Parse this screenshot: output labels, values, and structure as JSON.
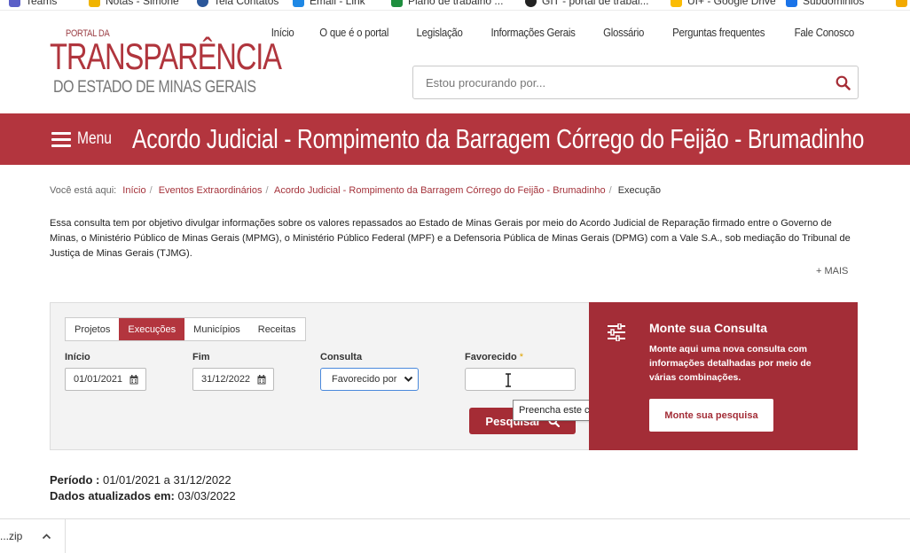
{
  "bookmarks": [
    {
      "label": "Teams",
      "color": "#5b5fc7"
    },
    {
      "label": "Notas - Simone",
      "color": "#f0b400"
    },
    {
      "label": "Tela Contatos",
      "color": "#2b579a"
    },
    {
      "label": "Email - Link",
      "color": "#1e88e5"
    },
    {
      "label": "Plano de trabalho ...",
      "color": "#1e8e3e"
    },
    {
      "label": "GIT - portal de trabal...",
      "color": "#222222"
    },
    {
      "label": "UI+ - Google Drive",
      "color": "#fbbc04"
    },
    {
      "label": "Subdominios",
      "color": "#1a73e8"
    }
  ],
  "logo": {
    "small": "PORTAL DA",
    "big": "TRANSPARÊNCIA",
    "sub": "DO ESTADO DE MINAS GERAIS"
  },
  "topnav": [
    "Início",
    "O que é o portal",
    "Legislação",
    "Informações Gerais",
    "Glossário",
    "Perguntas frequentes",
    "Fale Conosco"
  ],
  "search": {
    "placeholder": "Estou procurando por..."
  },
  "banner": {
    "menu_label": "Menu",
    "title": "Acordo Judicial - Rompimento da Barragem Córrego do Feijão - Brumadinho"
  },
  "breadcrumb": {
    "prefix": "Você está aqui:",
    "items": [
      "Início",
      "Eventos Extraordinários",
      "Acordo Judicial - Rompimento da Barragem Córrego do Feijão - Brumadinho"
    ],
    "current": "Execução"
  },
  "intro": "Essa consulta tem por objetivo divulgar informações sobre os valores repassados ao Estado de Minas Gerais por meio do Acordo Judicial de Reparação firmado entre o Governo de Minas, o Ministério Público de Minas Gerais (MPMG), o Ministério Público Federal (MPF) e a Defensoria Pública de Minas Gerais (DPMG) com a Vale S.A., sob mediação do Tribunal de Justiça de Minas Gerais (TJMG).",
  "mais_label": "+ MAIS",
  "query": {
    "tabs": [
      "Projetos",
      "Execuções",
      "Municípios",
      "Receitas"
    ],
    "active_tab": "Execuções",
    "inicio_label": "Início",
    "inicio_value": "01/01/2021",
    "fim_label": "Fim",
    "fim_value": "31/12/2022",
    "consulta_label": "Consulta",
    "consulta_value": "Favorecido por",
    "favorecido_label": "Favorecido",
    "favorecido_required": "*",
    "search_button": "Pesquisar",
    "tooltip": "Preencha este campo."
  },
  "monte": {
    "title": "Monte sua Consulta",
    "description": "Monte aqui uma nova consulta com informações detalhadas por meio de várias combinações.",
    "button": "Monte sua pesquisa"
  },
  "info": {
    "periodo_label": "Período :",
    "periodo_value": "01/01/2021 a 31/12/2022",
    "atualizados_label": "Dados atualizados em:",
    "atualizados_value": "03/03/2022"
  },
  "downloads": {
    "file_label": "...zip"
  },
  "colors": {
    "brand_red": "#b3353e",
    "panel_red": "#a32d37",
    "select_focus": "#4a89dc"
  }
}
